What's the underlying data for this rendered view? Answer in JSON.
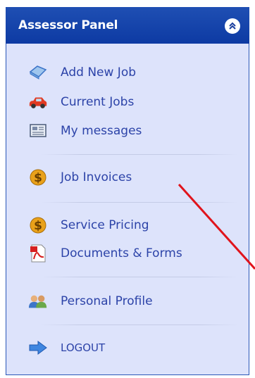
{
  "panel": {
    "title": "Assessor Panel"
  },
  "menu": {
    "add_new_job": "Add New Job",
    "current_jobs": "Current Jobs",
    "my_messages": "My messages",
    "job_invoices": "Job Invoices",
    "service_pricing": "Service Pricing",
    "documents_forms": "Documents & Forms",
    "personal_profile": "Personal Profile",
    "logout": "LOGOUT"
  },
  "colors": {
    "header_bg": "#0d3aa3",
    "panel_bg": "#dde3fb",
    "link_text": "#2c43a8",
    "annotation_arrow": "#e0141c"
  }
}
